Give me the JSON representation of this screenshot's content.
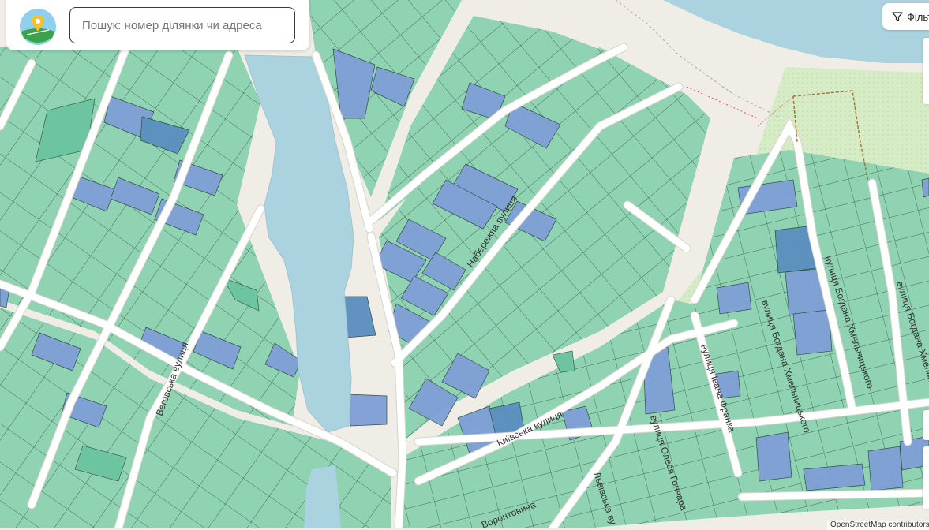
{
  "search": {
    "placeholder": "Пошук: номер ділянки чи адреса"
  },
  "filter_button": {
    "label": "Фільтри",
    "icon": "funnel-icon"
  },
  "attribution": "OpenStreetMap contributors",
  "streets": {
    "naberezhna": "Набережна вулиця",
    "vehovska": "Веговська вулиця",
    "kyivska": "Київська вулиця",
    "ivana_franka": "вулиця Івана Франка",
    "lesi_hmel1": "вулиця Богдана Хмельницького",
    "lesi_hmel2": "вулиця Богдана Хмельницького",
    "lesi_hmel3": "вулиця Богдана Хмельницького",
    "olesia_honchara": "вулиця Олеся Гончара",
    "lvivska": "Львівська ву",
    "vorontsovycha": "Воронтовича"
  },
  "colors": {
    "water": "#aad3df",
    "parcel": "#8fd3b3",
    "parcel_dark": "#6cc4a0",
    "parcel_selected": "#7f9fd6",
    "parcel_border": "#2c4a3c",
    "road": "#ffffff",
    "land": "#f0ede6",
    "park": "#cdebb0"
  }
}
